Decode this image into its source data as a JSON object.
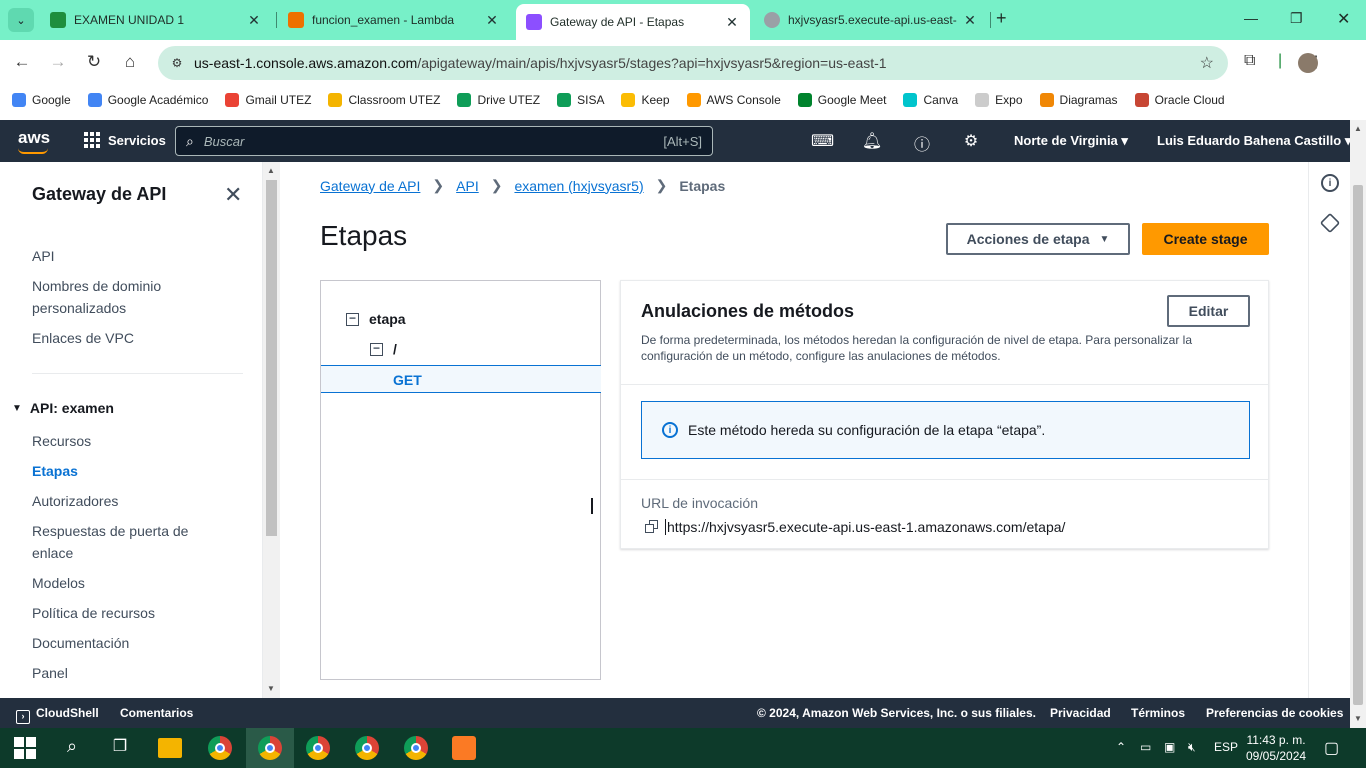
{
  "browser": {
    "tabs": [
      {
        "label": "EXAMEN UNIDAD 1",
        "color": "#1e8e3e"
      },
      {
        "label": "funcion_examen - Lambda",
        "color": "#ed7100"
      },
      {
        "label": "Gateway de API - Etapas",
        "color": "#8c4fff"
      },
      {
        "label": "hxjvsyasr5.execute-api.us-east-",
        "color": "#9aa0a6"
      }
    ],
    "url_host": "us-east-1.console.aws.amazon.com",
    "url_path": "/apigateway/main/apis/hxjvsyasr5/stages?api=hxjvsyasr5&region=us-east-1",
    "bookmarks": [
      {
        "label": "Google",
        "color": "#4285f4"
      },
      {
        "label": "Google Académico",
        "color": "#4285f4"
      },
      {
        "label": "Gmail UTEZ",
        "color": "#ea4335"
      },
      {
        "label": "Classroom UTEZ",
        "color": "#f4b400"
      },
      {
        "label": "Drive UTEZ",
        "color": "#0f9d58"
      },
      {
        "label": "SISA",
        "color": "#0f9d58"
      },
      {
        "label": "Keep",
        "color": "#fbbc04"
      },
      {
        "label": "AWS Console",
        "color": "#ff9900"
      },
      {
        "label": "Google Meet",
        "color": "#00832d"
      },
      {
        "label": "Canva",
        "color": "#00c4cc"
      },
      {
        "label": "Expo",
        "color": "#cccccc"
      },
      {
        "label": "Diagramas",
        "color": "#f08705"
      },
      {
        "label": "Oracle Cloud",
        "color": "#c74634"
      }
    ]
  },
  "aws_nav": {
    "logo": "aws",
    "services": "Servicios",
    "search_placeholder": "Buscar",
    "search_shortcut": "[Alt+S]",
    "region": "Norte de Virginia",
    "user": "Luis Eduardo Bahena Castillo"
  },
  "sidenav": {
    "title": "Gateway de API",
    "top_items": [
      "API",
      "Nombres de dominio personalizados",
      "Enlaces de VPC"
    ],
    "section": "API: examen",
    "section_items": [
      "Recursos",
      "Etapas",
      "Autorizadores",
      "Respuestas de puerta de enlace",
      "Modelos",
      "Política de recursos",
      "Documentación",
      "Panel"
    ],
    "active": "Etapas"
  },
  "main": {
    "breadcrumb": [
      "Gateway de API",
      "API",
      "examen (hxjvsyasr5)",
      "Etapas"
    ],
    "title": "Etapas",
    "actions_button": "Acciones de etapa",
    "create_button": "Create stage",
    "tree": {
      "stage": "etapa",
      "resource": "/",
      "method": "GET"
    },
    "detail": {
      "title": "Anulaciones de métodos",
      "edit_button": "Editar",
      "description": "De forma predeterminada, los métodos heredan la configuración de nivel de etapa. Para personalizar la configuración de un método, configure las anulaciones de métodos.",
      "info": "Este método hereda su configuración de la etapa “etapa”.",
      "url_label": "URL de invocación",
      "url": "https://hxjvsyasr5.execute-api.us-east-1.amazonaws.com/etapa/"
    }
  },
  "footer": {
    "cloudshell": "CloudShell",
    "feedback": "Comentarios",
    "copyright": "© 2024, Amazon Web Services, Inc. o sus filiales.",
    "privacy": "Privacidad",
    "terms": "Términos",
    "cookies": "Preferencias de cookies"
  },
  "taskbar": {
    "lang": "ESP",
    "time": "11:43 p. m.",
    "date": "09/05/2024"
  }
}
